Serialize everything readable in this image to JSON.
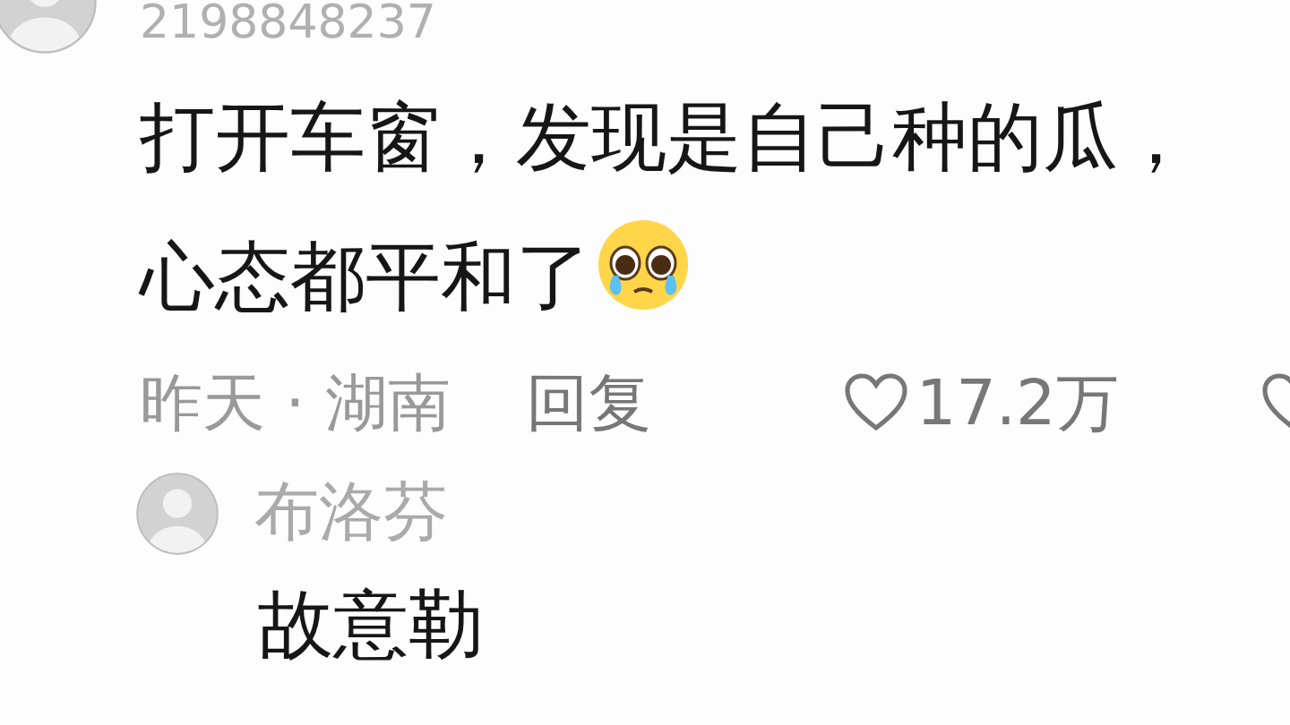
{
  "comment": {
    "username": "2198848237",
    "text": "打开车窗，发现是自己种的瓜，心态都平和了",
    "meta": "昨天 · 湖南",
    "reply_button": "回复",
    "likes": "17.2万"
  },
  "reply": {
    "username": "布洛芬",
    "text": "故意勒"
  }
}
